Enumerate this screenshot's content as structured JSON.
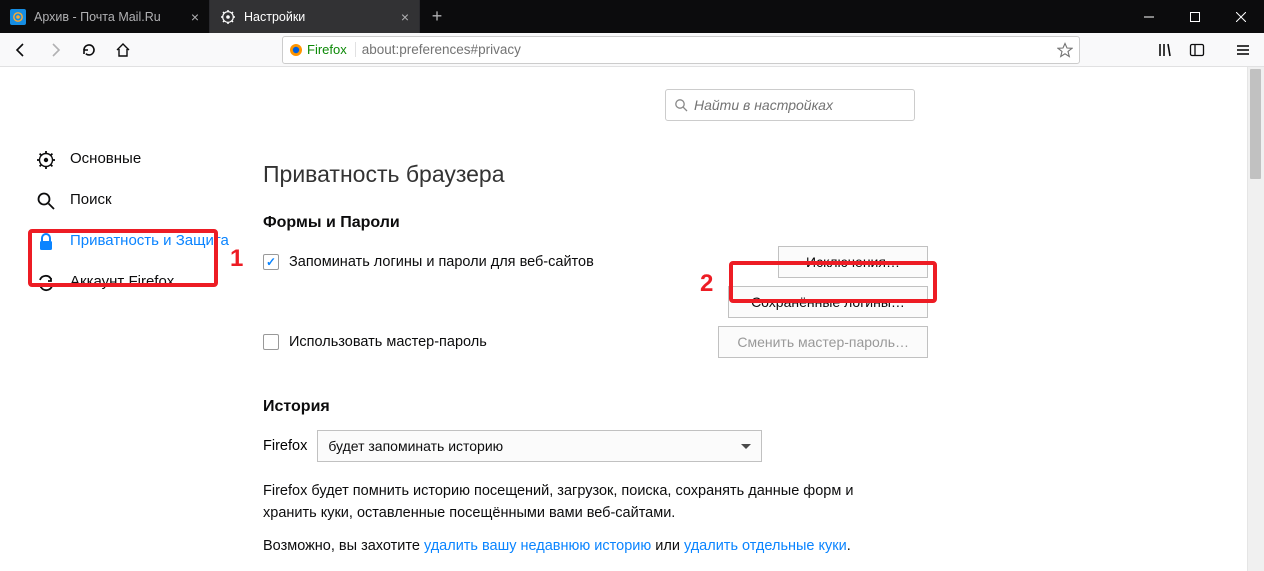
{
  "tabs": [
    {
      "label": "Архив - Почта Mail.Ru"
    },
    {
      "label": "Настройки"
    }
  ],
  "urlbar": {
    "identity": "Firefox",
    "url": "about:preferences#privacy"
  },
  "search": {
    "placeholder": "Найти в настройках"
  },
  "sidebar": {
    "general": "Основные",
    "search": "Поиск",
    "privacy": "Приватность и Защита",
    "account": "Аккаунт Firefox"
  },
  "page": {
    "title": "Приватность браузера",
    "formsSection": "Формы и Пароли",
    "rememberLogins": "Запоминать логины и пароли для веб-сайтов",
    "exceptions": "Исключения…",
    "savedLogins": "Сохранённые логины…",
    "useMaster": "Использовать мастер-пароль",
    "changeMaster": "Сменить мастер-пароль…",
    "historySection": "История",
    "historyLabel": "Firefox",
    "historySelect": "будет запоминать историю",
    "historyPara1": "Firefox будет помнить историю посещений, загрузок, поиска, сохранять данные форм и хранить куки, оставленные посещёнными вами веб-сайтами.",
    "historyPara2a": "Возможно, вы захотите ",
    "historyLink1": "удалить вашу недавнюю историю",
    "historyPara2b": " или ",
    "historyLink2": "удалить отдельные куки",
    "historyPara2c": "."
  },
  "annotations": {
    "one": "1",
    "two": "2"
  }
}
